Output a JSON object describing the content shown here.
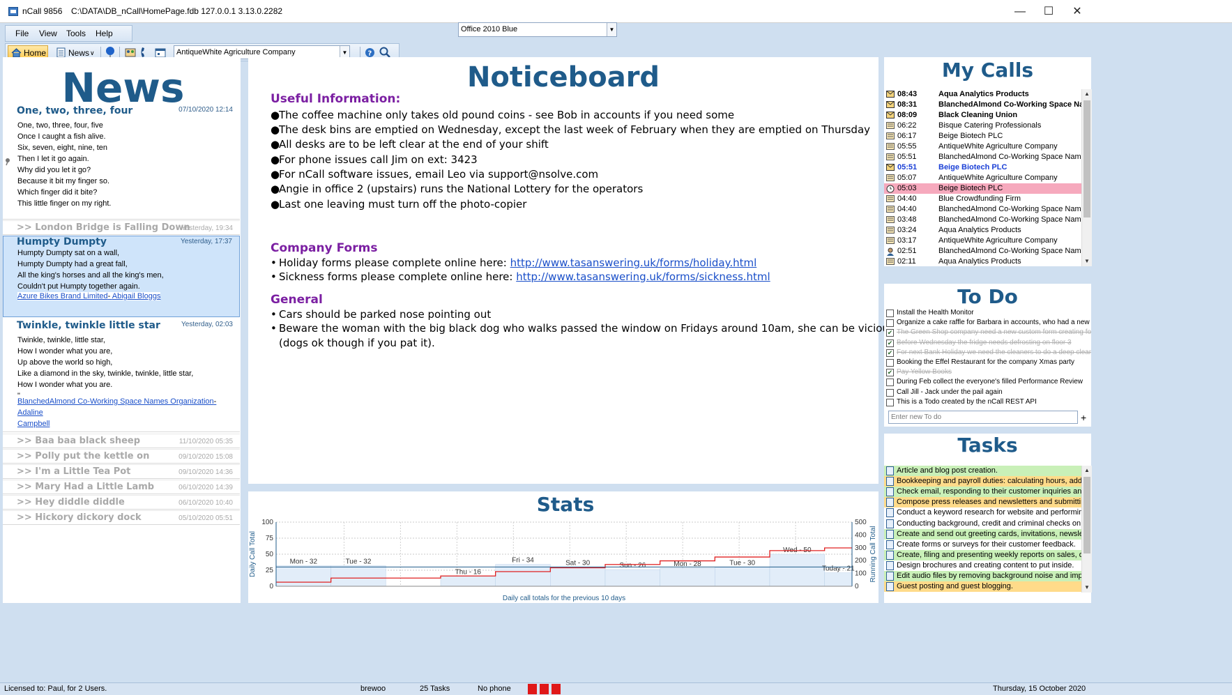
{
  "window": {
    "app_title": "nCall 9856",
    "path": "C:\\DATA\\DB_nCall\\HomePage.fdb 127.0.0.1 3.13.0.2282"
  },
  "menu": [
    "File",
    "View",
    "Tools",
    "Help"
  ],
  "theme_select": {
    "value": "Office 2010 Blue"
  },
  "toolbar": {
    "home_label": "Home",
    "news_label": "News",
    "company_select": "AntiqueWhite Agriculture Company"
  },
  "news": {
    "title": "News",
    "stories": [
      {
        "title": "One, two, three, four",
        "date": "07/10/2020 12:14",
        "body": "One, two, three, four, five\nOnce I caught a fish alive.\nSix, seven, eight, nine, ten\nThen I let it go again.\nWhy did you let it go?\nBecause it bit my finger so.\nWhich finger did it bite?\nThis little finger on my right."
      },
      {
        "title": "Humpty Dumpty",
        "date": "Yesterday, 17:37",
        "body": "Humpty Dumpty sat on a wall,\nHumpty Dumpty had a great fall,\nAll the king's horses and all the king's men,\nCouldn't put Humpty together again.",
        "link1": "Azure Bikes Brand Limited",
        "link2": "Abigail Bloggs"
      },
      {
        "title": "Twinkle, twinkle little star",
        "date": "Yesterday, 02:03",
        "body": "Twinkle, twinkle, little star,\nHow I wonder what you are,\nUp above the world so high,\nLike a diamond in the sky, twinkle, twinkle, little star,\nHow I wonder what you are.\n\"",
        "link1": "BlanchedAlmond Co-Working Space Names Organization",
        "link2a": "Adaline",
        "link2b": "Campbell"
      }
    ],
    "collapsed": [
      {
        "title": ">> London Bridge is Falling Down",
        "date": "Yesterday, 19:34"
      },
      {
        "title": ">> Baa baa black sheep",
        "date": "11/10/2020 05:35"
      },
      {
        "title": ">> Polly put the kettle on",
        "date": "09/10/2020 15:08"
      },
      {
        "title": ">> I'm a Little Tea Pot",
        "date": "09/10/2020 14:36"
      },
      {
        "title": ">> Mary Had a Little Lamb",
        "date": "06/10/2020 14:39"
      },
      {
        "title": ">> Hey diddle diddle",
        "date": "06/10/2020 10:40"
      },
      {
        "title": ">> Hickory dickory dock",
        "date": "05/10/2020 05:51"
      }
    ]
  },
  "noticeboard": {
    "title": "Noticeboard",
    "useful_heading": "Useful Information:",
    "useful_items": [
      "The coffee machine only takes old pound coins - see Bob in accounts if you need some",
      "The desk bins are emptied on Wednesday, except the last week of February when they are emptied on Thursday",
      "All desks are to be left clear at the end of your shift",
      "For phone issues call Jim on ext: 3423",
      "For nCall software issues, email Leo via support@nsolve.com",
      "Angie in office 2 (upstairs) runs the National Lottery for the operators",
      "Last one leaving must turn off the photo-copier"
    ],
    "forms_heading": "Company Forms",
    "forms": [
      {
        "text": "Holiday forms please complete online here: ",
        "link": "http://www.tasanswering.uk/forms/holiday.html"
      },
      {
        "text": "Sickness forms please complete online here: ",
        "link": "http://www.tasanswering.uk/forms/sickness.html"
      }
    ],
    "general_heading": "General",
    "general_items": [
      "Cars should be parked nose pointing out",
      "Beware the woman with the big black dog who walks passed the window on Fridays around 10am, she can be vicious",
      "(dogs ok though if you pat it)."
    ]
  },
  "stats": {
    "title": "Stats",
    "chart_data": {
      "type": "bar",
      "categories": [
        "Mon",
        "Tue",
        "Wed",
        "Thu",
        "Fri",
        "Sat",
        "Sun",
        "Mon",
        "Tue",
        "Wed",
        "Today"
      ],
      "bar_labels": [
        "Mon - 32",
        "Tue - 32",
        "",
        "Thu - 16",
        "Fri - 34",
        "Sat - 30",
        "Sun - 26",
        "Mon - 28",
        "Tue - 30",
        "Wed - 50",
        "Today - 21"
      ],
      "series": [
        {
          "name": "Daily Call Total",
          "values": [
            32,
            32,
            0,
            16,
            34,
            30,
            26,
            28,
            30,
            50,
            21
          ]
        },
        {
          "name": "Running Call Total",
          "values": [
            32,
            64,
            64,
            80,
            114,
            144,
            170,
            198,
            228,
            278,
            299
          ]
        }
      ],
      "xlabel": "Daily call totals for the previous 10 days",
      "ylabel": "Daily Call Total",
      "y2label": "Running Call Total",
      "ylim": [
        0,
        100
      ],
      "y2lim": [
        0,
        500
      ],
      "yticks": [
        "0",
        "25",
        "50",
        "75",
        "100"
      ],
      "y2ticks": [
        "0",
        "100",
        "200",
        "300",
        "400",
        "500"
      ],
      "mean_line": 30,
      "colors": {
        "bar": "#e2edf9",
        "line": "#e02020",
        "mean": "#1f5b8a"
      }
    }
  },
  "my_calls": {
    "title": "My Calls",
    "rows": [
      {
        "time": "08:43",
        "name": "Aqua Analytics Products",
        "icon": "envelope-icon",
        "bold": true
      },
      {
        "time": "08:31",
        "name": "BlanchedAlmond Co-Working Space Name",
        "icon": "envelope-icon",
        "bold": true
      },
      {
        "time": "08:09",
        "name": "Black Cleaning Union",
        "icon": "envelope-icon",
        "bold": true
      },
      {
        "time": "06:22",
        "name": "Bisque Catering Professionals",
        "icon": "message-icon"
      },
      {
        "time": "06:17",
        "name": "Beige Biotech PLC",
        "icon": "message-icon"
      },
      {
        "time": "05:55",
        "name": "AntiqueWhite Agriculture Company",
        "icon": "message-icon"
      },
      {
        "time": "05:51",
        "name": "BlanchedAlmond Co-Working Space Names",
        "icon": "message-icon"
      },
      {
        "time": "05:51",
        "name": "Beige Biotech PLC",
        "icon": "envelope-icon",
        "bold": true,
        "blue": true
      },
      {
        "time": "05:07",
        "name": "AntiqueWhite Agriculture Company",
        "icon": "message-icon"
      },
      {
        "time": "05:03",
        "name": "Beige Biotech PLC",
        "icon": "clock-icon",
        "highlight": true
      },
      {
        "time": "04:40",
        "name": "Blue Crowdfunding Firm",
        "icon": "message-icon"
      },
      {
        "time": "04:40",
        "name": "BlanchedAlmond Co-Working Space Names",
        "icon": "message-icon"
      },
      {
        "time": "03:48",
        "name": "BlanchedAlmond Co-Working Space Names",
        "icon": "message-icon"
      },
      {
        "time": "03:24",
        "name": "Aqua Analytics Products",
        "icon": "message-icon"
      },
      {
        "time": "03:17",
        "name": "AntiqueWhite Agriculture Company",
        "icon": "message-icon"
      },
      {
        "time": "02:51",
        "name": "BlanchedAlmond Co-Working Space Names",
        "icon": "person-icon"
      },
      {
        "time": "02:11",
        "name": "Aqua Analytics Products",
        "icon": "message-icon"
      }
    ]
  },
  "todo": {
    "title": "To Do",
    "placeholder": "Enter new To do",
    "add_label": "+",
    "items": [
      {
        "text": "Install the Health Monitor",
        "done": false
      },
      {
        "text": "Organize a cake raffle for Barbara in accounts, who had a new",
        "done": false
      },
      {
        "text": "The Green Shop company need a new custom form creating for",
        "done": true
      },
      {
        "text": "Before Wednesday the fridge needs defrosting on floor 3",
        "done": true
      },
      {
        "text": "For next Bank Holiday we need the cleaners to do a deep clean",
        "done": true
      },
      {
        "text": "Booking the Effel Restaurant for the company Xmas party",
        "done": false
      },
      {
        "text": "Pay Yellow Books",
        "done": true
      },
      {
        "text": "During Feb collect the everyone's filled Performance Review",
        "done": false
      },
      {
        "text": "Call Jill - Jack under the pail again",
        "done": false
      },
      {
        "text": "This is a Todo created by the nCall REST API",
        "done": false
      }
    ]
  },
  "tasks": {
    "title": "Tasks",
    "items": [
      {
        "text": "Article and blog post creation.",
        "color": "#c9f0b8"
      },
      {
        "text": "Bookkeeping and payroll duties: calculating hours, addin",
        "color": "#ffdb8a"
      },
      {
        "text": "Check email, responding to their customer inquiries and",
        "color": "#c9f0b8"
      },
      {
        "text": "Compose press releases and newsletters and submitting",
        "color": "#ffdb8a"
      },
      {
        "text": "Conduct a keyword research for website and performing",
        "color": "#ffffff"
      },
      {
        "text": "Conducting background, credit and criminal checks on s",
        "color": "#ffffff"
      },
      {
        "text": "Create and send out greeting cards, invitations, newslette",
        "color": "#c9f0b8"
      },
      {
        "text": "Create forms or surveys for their customer feedback.",
        "color": "#ffffff"
      },
      {
        "text": "Create, filing and presenting weekly reports on sales, deli",
        "color": "#c9f0b8"
      },
      {
        "text": "Design brochures and creating content to put inside.",
        "color": "#ffffff"
      },
      {
        "text": "Edit audio files by removing background noise and impr",
        "color": "#c9f0b8"
      },
      {
        "text": "Guest posting and guest blogging.",
        "color": "#ffdb8a"
      }
    ]
  },
  "statusbar": {
    "license": "Licensed to: Paul, for 2 Users.",
    "user": "brewoo",
    "tasks": "25 Tasks",
    "phone": "No phone",
    "date": "Thursday, 15 October 2020"
  }
}
